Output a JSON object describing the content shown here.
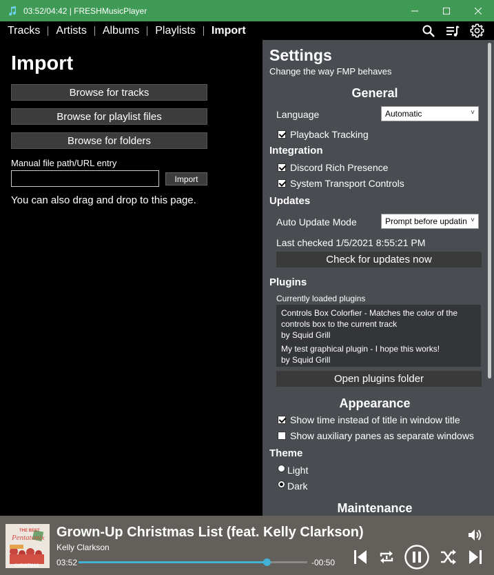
{
  "window": {
    "title": "03:52/04:42 | FRESHMusicPlayer",
    "minimize_glyph": "—",
    "accent_color": "#3f9a55"
  },
  "nav": {
    "tabs": [
      {
        "label": "Tracks"
      },
      {
        "label": "Artists"
      },
      {
        "label": "Albums"
      },
      {
        "label": "Playlists"
      },
      {
        "label": "Import"
      }
    ],
    "active": "Import",
    "icons": [
      "search-icon",
      "queue-icon",
      "settings-gear-icon"
    ]
  },
  "import": {
    "title": "Import",
    "browse_tracks": "Browse for tracks",
    "browse_playlists": "Browse for playlist files",
    "browse_folders": "Browse for folders",
    "manual_label": "Manual file path/URL entry",
    "manual_value": "",
    "import_button": "Import",
    "drag_drop": "You can also drag and drop to this page."
  },
  "settings": {
    "title": "Settings",
    "subtitle": "Change the way FMP behaves",
    "general": {
      "heading": "General",
      "language_label": "Language",
      "language_value": "Automatic",
      "playback_tracking": {
        "label": "Playback Tracking",
        "checked": true
      }
    },
    "integration": {
      "heading": "Integration",
      "discord": {
        "label": "Discord Rich Presence",
        "checked": true
      },
      "smtc": {
        "label": "System Transport Controls",
        "checked": true
      }
    },
    "updates": {
      "heading": "Updates",
      "mode_label": "Auto Update Mode",
      "mode_value": "Prompt before updating",
      "last_checked": "Last checked 1/5/2021 8:55:21 PM",
      "check_button": "Check for updates now"
    },
    "plugins": {
      "heading": "Plugins",
      "loaded_label": "Currently loaded plugins",
      "items": [
        {
          "description": "Controls Box Colorfier - Matches the color of the controls box to the current track",
          "author": "by Squid Grill"
        },
        {
          "description": "My test graphical plugin - I hope this works!",
          "author": "by Squid Grill"
        }
      ],
      "open_button": "Open plugins folder"
    },
    "appearance": {
      "heading": "Appearance",
      "time_in_title": {
        "label": "Show time instead of title in window title",
        "checked": true
      },
      "aux_panes": {
        "label": "Show auxiliary panes as separate windows",
        "checked": false
      }
    },
    "theme": {
      "heading": "Theme",
      "options": [
        {
          "label": "Light",
          "selected": false
        },
        {
          "label": "Dark",
          "selected": true
        }
      ]
    },
    "maintenance": {
      "heading": "Maintenance"
    }
  },
  "player": {
    "track_title": "Grown-Up Christmas List (feat. Kelly Clarkson)",
    "artist": "Kelly Clarkson",
    "current_time": "03:52",
    "remaining_time": "-00:50",
    "progress": 0.8227,
    "album_art_text": [
      "THE BEST",
      "Pentatonix",
      "CHRISTMAS"
    ],
    "progress_color": "#41b3d7"
  }
}
